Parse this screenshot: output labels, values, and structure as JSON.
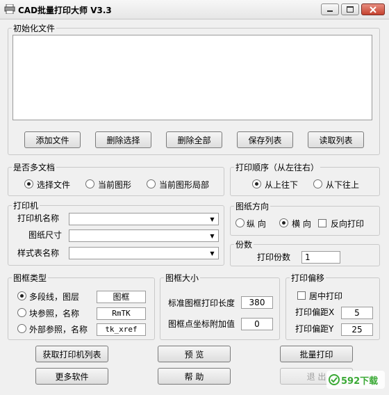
{
  "window": {
    "title": "CAD批量打印大师 V3.3"
  },
  "init_files": {
    "group_title": "初始化文件",
    "buttons": {
      "add": "添加文件",
      "delete_selected": "删除选择",
      "delete_all": "删除全部",
      "save_list": "保存列表",
      "read_list": "读取列表"
    }
  },
  "multi_doc": {
    "group_title": "是否多文档",
    "options": [
      "选择文件",
      "当前图形",
      "当前图形局部"
    ],
    "selected": "选择文件"
  },
  "print_order": {
    "group_title": "打印顺序（从左往右）",
    "options": [
      "从上往下",
      "从下往上"
    ],
    "selected": "从上往下"
  },
  "printer": {
    "group_title": "打印机",
    "printer_name_label": "打印机名称",
    "paper_size_label": "图纸尺寸",
    "style_table_label": "样式表名称"
  },
  "orientation": {
    "group_title": "图纸方向",
    "portrait": "纵 向",
    "landscape": "横 向",
    "reverse": "反向打印",
    "selected": "横 向"
  },
  "copies": {
    "group_title": "份数",
    "label": "打印份数",
    "value": "1"
  },
  "frame_type": {
    "group_title": "图框类型",
    "options": [
      {
        "label": "多段线，图层",
        "value": "图框"
      },
      {
        "label": "块参照，名称",
        "value": "RmTK"
      },
      {
        "label": "外部参照，名称",
        "value": "tk_xref"
      }
    ],
    "selected": "多段线，图层"
  },
  "frame_size": {
    "group_title": "图框大小",
    "length_label": "标准图框打印长度",
    "length_value": "380",
    "offset_label": "图框点坐标附加值",
    "offset_value": "0"
  },
  "print_offset": {
    "group_title": "打印偏移",
    "center_label": "居中打印",
    "x_label": "打印偏距X",
    "x_value": "5",
    "y_label": "打印偏距Y",
    "y_value": "25"
  },
  "bottom_buttons": {
    "get_printers": "获取打印机列表",
    "preview": "预 览",
    "batch_print": "批量打印",
    "more_software": "更多软件",
    "help": "帮 助",
    "exit": "退 出"
  },
  "watermark": {
    "text": "592下载"
  },
  "colors": {
    "watermark_green": "#3aa935",
    "close_red": "#c5432f"
  }
}
